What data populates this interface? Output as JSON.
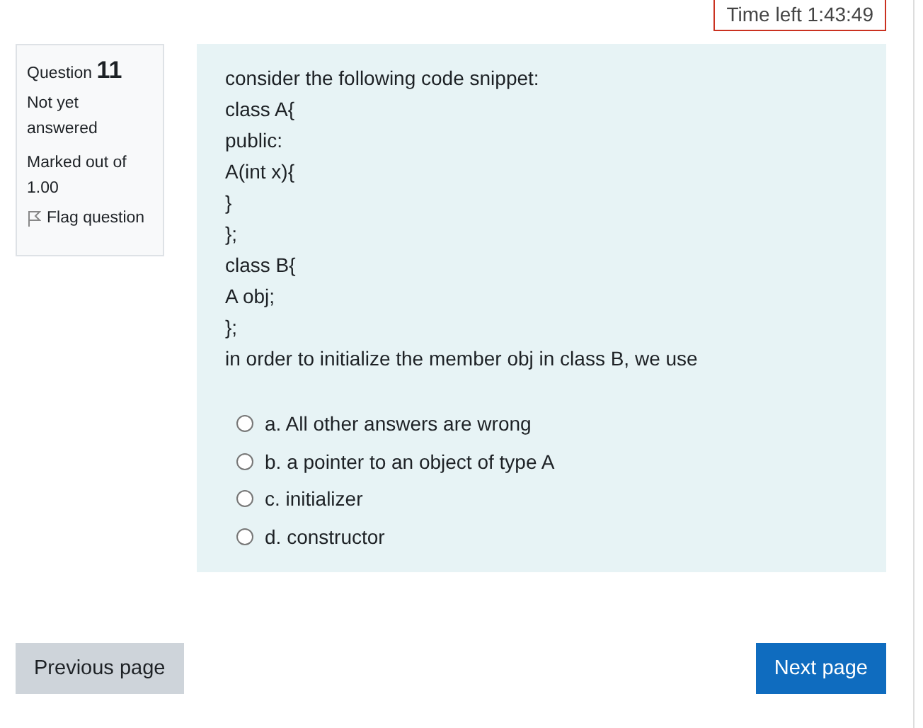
{
  "timer": {
    "label": "Time left 1:43:49"
  },
  "question_info": {
    "label": "Question",
    "number": "11",
    "status": "Not yet answered",
    "mark": "Marked out of 1.00",
    "flag": {
      "label": "Flag question",
      "flagged": false
    }
  },
  "question": {
    "lines": [
      "consider the following code snippet:",
      "class A{",
      "public:",
      "A(int x){",
      "}",
      "};",
      "class B{",
      "A obj;",
      "};",
      "in order to initialize the member obj in class B, we use"
    ],
    "options": [
      {
        "label": "a. All other answers are wrong",
        "selected": false
      },
      {
        "label": "b. a pointer to an object of type A",
        "selected": false
      },
      {
        "label": "c. initializer",
        "selected": false
      },
      {
        "label": "d. constructor",
        "selected": false
      }
    ]
  },
  "buttons": [
    {
      "label": "Previous page",
      "kind": "secondary"
    },
    {
      "label": "Next page",
      "kind": "primary"
    }
  ]
}
